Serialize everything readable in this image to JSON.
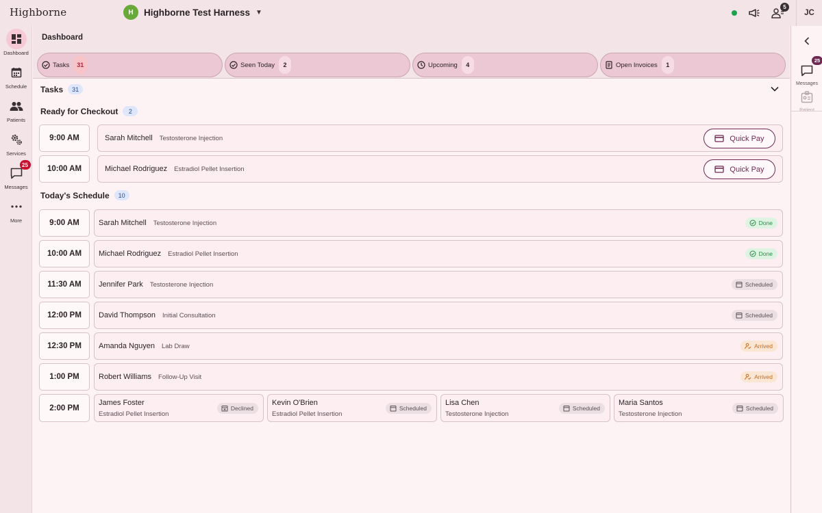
{
  "app": {
    "brand": "Highborne",
    "org_initial": "H",
    "org_name": "Highborne Test Harness",
    "user_initials": "JC",
    "team_badge": "5"
  },
  "nav": {
    "items": [
      {
        "label": "Dashboard",
        "icon": "dashboard-icon",
        "active": true
      },
      {
        "label": "Schedule",
        "icon": "calendar-icon"
      },
      {
        "label": "Patients",
        "icon": "people-icon"
      },
      {
        "label": "Services",
        "icon": "gears-icon"
      },
      {
        "label": "Messages",
        "icon": "chat-icon",
        "badge": "25"
      },
      {
        "label": "More",
        "icon": "more-icon"
      }
    ]
  },
  "rail": {
    "messages_label": "Messages",
    "messages_badge": "25",
    "patient_label": "Patient"
  },
  "page": {
    "title": "Dashboard"
  },
  "summary_tabs": [
    {
      "label": "Tasks",
      "count": "31",
      "icon": "check-circle-icon"
    },
    {
      "label": "Seen Today",
      "count": "2",
      "icon": "check-circle-icon"
    },
    {
      "label": "Upcoming",
      "count": "4",
      "icon": "clock-icon"
    },
    {
      "label": "Open Invoices",
      "count": "1",
      "icon": "invoice-icon"
    }
  ],
  "tasks": {
    "title": "Tasks",
    "count": "31"
  },
  "checkout": {
    "title": "Ready for Checkout",
    "count": "2",
    "button_label": "Quick Pay",
    "rows": [
      {
        "time": "9:00 AM",
        "patient": "Sarah Mitchell",
        "service": "Testosterone Injection"
      },
      {
        "time": "10:00 AM",
        "patient": "Michael Rodriguez",
        "service": "Estradiol Pellet Insertion"
      }
    ]
  },
  "schedule": {
    "title": "Today's Schedule",
    "count": "10",
    "rows": [
      {
        "time": "9:00 AM",
        "patient": "Sarah Mitchell",
        "service": "Testosterone Injection",
        "status": "Done"
      },
      {
        "time": "10:00 AM",
        "patient": "Michael Rodriguez",
        "service": "Estradiol Pellet Insertion",
        "status": "Done"
      },
      {
        "time": "11:30 AM",
        "patient": "Jennifer Park",
        "service": "Testosterone Injection",
        "status": "Scheduled"
      },
      {
        "time": "12:00 PM",
        "patient": "David Thompson",
        "service": "Initial Consultation",
        "status": "Scheduled"
      },
      {
        "time": "12:30 PM",
        "patient": "Amanda Nguyen",
        "service": "Lab Draw",
        "status": "Arrived"
      },
      {
        "time": "1:00 PM",
        "patient": "Robert Williams",
        "service": "Follow-Up Visit",
        "status": "Arrived"
      }
    ],
    "group": {
      "time": "2:00 PM",
      "cards": [
        {
          "patient": "James Foster",
          "service": "Estradiol Pellet Insertion",
          "status": "Declined"
        },
        {
          "patient": "Kevin O'Brien",
          "service": "Estradiol Pellet Insertion",
          "status": "Scheduled"
        },
        {
          "patient": "Lisa Chen",
          "service": "Testosterone Injection",
          "status": "Scheduled"
        },
        {
          "patient": "Maria Santos",
          "service": "Testosterone Injection",
          "status": "Scheduled"
        }
      ]
    }
  },
  "colors": {
    "accent": "#6e2a52",
    "done": "#2d8a46",
    "arrived": "#c36a20",
    "alert": "#c8102e"
  }
}
